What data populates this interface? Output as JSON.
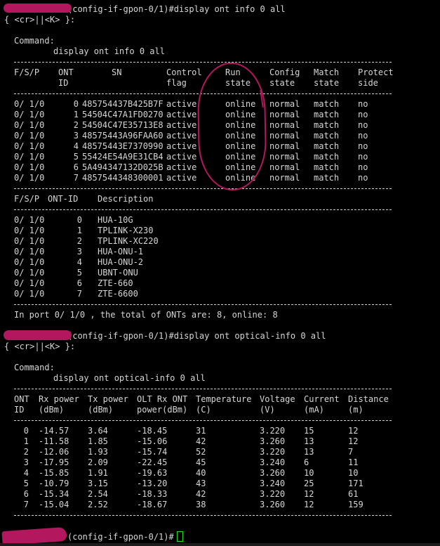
{
  "terminal": {
    "prompt_suffix": "N(config-if-gpon-0/1)#",
    "prompt_suffix_partial": "(config-if-gpon-0/1)#",
    "cmd1": "display ont info 0 all",
    "cmd2": "display ont optical-info 0 all",
    "hint": "{ <cr>||<K> }:",
    "command_label": "Command:",
    "info_table": {
      "headers1": [
        "F/S/P",
        "ONT",
        "SN",
        "Control",
        "Run",
        "Config",
        "Match",
        "Protect"
      ],
      "headers2": [
        "",
        "ID",
        "",
        "flag",
        "state",
        "state",
        "state",
        "side"
      ],
      "rows": [
        [
          "0/ 1/0",
          "0",
          "485754437B425B7F",
          "active",
          "online",
          "normal",
          "match",
          "no"
        ],
        [
          "0/ 1/0",
          "1",
          "54504C47A1FD0270",
          "active",
          "online",
          "normal",
          "match",
          "no"
        ],
        [
          "0/ 1/0",
          "2",
          "54504C47E35713E8",
          "active",
          "online",
          "normal",
          "match",
          "no"
        ],
        [
          "0/ 1/0",
          "3",
          "48575443A96FAA60",
          "active",
          "online",
          "normal",
          "match",
          "no"
        ],
        [
          "0/ 1/0",
          "4",
          "48575443E7370990",
          "active",
          "online",
          "normal",
          "match",
          "no"
        ],
        [
          "0/ 1/0",
          "5",
          "55424E54A9E31CB4",
          "active",
          "online",
          "normal",
          "match",
          "no"
        ],
        [
          "0/ 1/0",
          "6",
          "5A494347132D025B",
          "active",
          "online",
          "normal",
          "match",
          "no"
        ],
        [
          "0/ 1/0",
          "7",
          "4857544348300001",
          "active",
          "online",
          "normal",
          "match",
          "no"
        ]
      ]
    },
    "desc_table": {
      "headers": [
        "F/S/P",
        "ONT-ID",
        "Description"
      ],
      "rows": [
        [
          "0/ 1/0",
          "0",
          "HUA-10G"
        ],
        [
          "0/ 1/0",
          "1",
          "TPLINK-X230"
        ],
        [
          "0/ 1/0",
          "2",
          "TPLINK-XC220"
        ],
        [
          "0/ 1/0",
          "3",
          "HUA-ONU-1"
        ],
        [
          "0/ 1/0",
          "4",
          "HUA-ONU-2"
        ],
        [
          "0/ 1/0",
          "5",
          "UBNT-ONU"
        ],
        [
          "0/ 1/0",
          "6",
          "ZTE-660"
        ],
        [
          "0/ 1/0",
          "7",
          "ZTE-6600"
        ]
      ]
    },
    "summary": "In port 0/ 1/0 , the total of ONTs are: 8, online: 8",
    "optical_table": {
      "headers1": [
        "ONT",
        "Rx power",
        "Tx power",
        "OLT Rx ONT",
        "Temperature",
        "Voltage",
        "Current",
        "Distance"
      ],
      "headers2": [
        "ID",
        "(dBm)",
        "(dBm)",
        "power(dBm)",
        "(C)",
        "(V)",
        "(mA)",
        "(m)"
      ],
      "rows": [
        [
          "0",
          "-14.57",
          "3.64",
          "-18.45",
          "31",
          "3.220",
          "15",
          "12"
        ],
        [
          "1",
          "-11.58",
          "1.85",
          "-15.06",
          "42",
          "3.260",
          "13",
          "12"
        ],
        [
          "2",
          "-12.06",
          "1.93",
          "-15.74",
          "52",
          "3.220",
          "13",
          "7"
        ],
        [
          "3",
          "-17.95",
          "2.09",
          "-22.45",
          "45",
          "3.240",
          "6",
          "11"
        ],
        [
          "4",
          "-15.85",
          "1.91",
          "-19.63",
          "40",
          "3.260",
          "10",
          "10"
        ],
        [
          "5",
          "-10.79",
          "3.15",
          "-13.20",
          "43",
          "3.240",
          "25",
          "171"
        ],
        [
          "6",
          "-15.34",
          "2.54",
          "-18.33",
          "42",
          "3.220",
          "12",
          "61"
        ],
        [
          "7",
          "-15.04",
          "2.52",
          "-18.67",
          "38",
          "3.260",
          "12",
          "159"
        ]
      ]
    }
  },
  "annotation_color": "#b3185e",
  "cursor_color": "#22dd22"
}
